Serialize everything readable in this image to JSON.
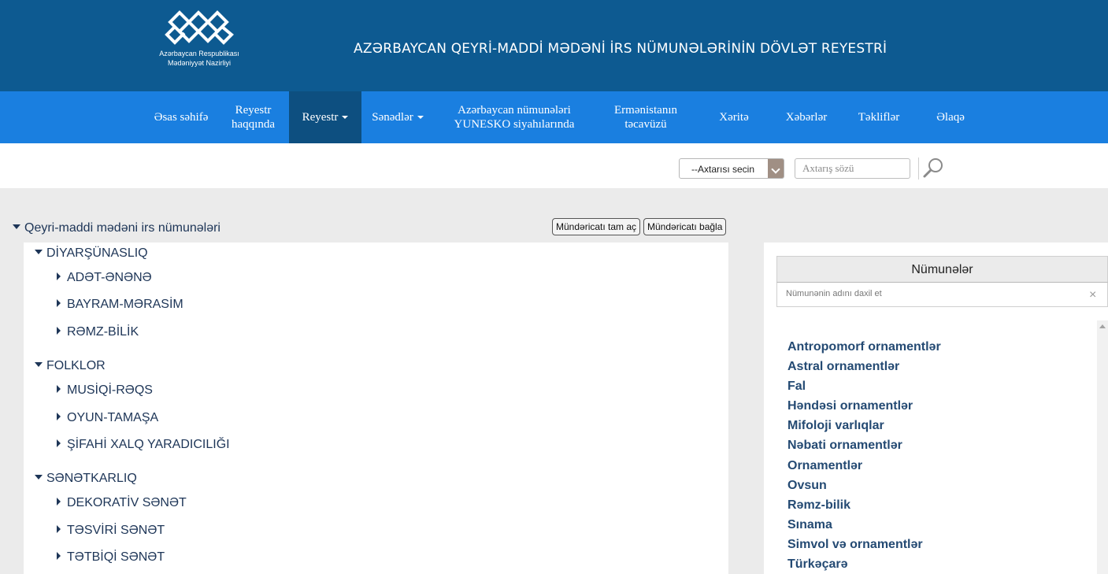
{
  "header": {
    "logo_line1": "Azərbaycan Respublikası",
    "logo_line2": "Mədəniyyət Nazirliyi",
    "site_title": "AZƏRBAYCAN QEYRİ-MADDİ MƏDƏNİ İRS NÜMUNƏLƏRİNİN DÖVLƏT REYESTRİ"
  },
  "nav": {
    "home": "Əsas səhifə",
    "about_line1": "Reyestr",
    "about_line2": "haqqında",
    "registry": "Reyestr",
    "documents": "Sənədlər",
    "unesco_line1": "Azərbaycan nümunələri",
    "unesco_line2": "YUNESKO siyahılarında",
    "aggression_line1": "Ermənistanın",
    "aggression_line2": "təcavüzü",
    "map": "Xəritə",
    "news": "Xəbərlər",
    "suggestions": "Təkliflər",
    "contact": "Əlaqə"
  },
  "search": {
    "select_value": "--Axtarısı secin",
    "input_placeholder": "Axtarış sözü"
  },
  "tree": {
    "root_label": "Qeyri-maddi mədəni irs nümunələri",
    "expand_all": "Mündəricatı tam aç",
    "collapse_all": "Mündəricatı bağla",
    "categories": [
      {
        "label": "DİYARŞÜNASLIQ",
        "children": [
          "ADƏT-ƏNƏNƏ",
          "BAYRAM-MƏRASİM",
          "RƏMZ-BİLİK"
        ]
      },
      {
        "label": "FOLKLOR",
        "children": [
          "MUSİQİ-RƏQS",
          "OYUN-TAMAŞA",
          "ŞİFAHİ XALQ YARADICILIĞI"
        ]
      },
      {
        "label": "SƏNƏTKARLIQ",
        "children": [
          "DEKORATİV SƏNƏT",
          "TƏSVİRİ SƏNƏT",
          "TƏTBİQİ SƏNƏT"
        ]
      }
    ]
  },
  "samples_panel": {
    "title": "Nümunələr",
    "filter_placeholder": "Nümunənin adını daxil et",
    "close_symbol": "×",
    "items": [
      "Antropomorf ornamentlər",
      "Astral ornamentlər",
      "Fal",
      "Həndəsi ornamentlər",
      "Mifoloji varlıqlar",
      "Nəbati ornamentlər",
      "Ornamentlər",
      "Ovsun",
      "Rəmz-bilik",
      "Sınama",
      "Simvol və ornamentlər",
      "Türkəçarə"
    ]
  },
  "colors": {
    "header_bg": "#0d5a91",
    "nav_bg": "#1a7fe0",
    "nav_active_bg": "#0d4f80",
    "tree_text": "#1d3557",
    "result_text": "#244a73"
  }
}
